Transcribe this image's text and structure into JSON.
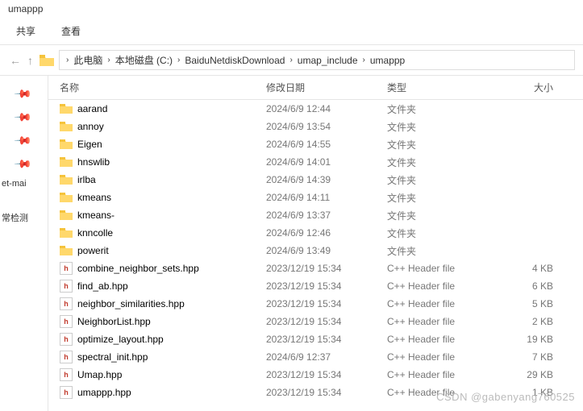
{
  "title": "umappp",
  "tabs": {
    "share": "共享",
    "view": "查看"
  },
  "breadcrumb": {
    "items": [
      "此电脑",
      "本地磁盘 (C:)",
      "BaiduNetdiskDownload",
      "umap_include",
      "umappp"
    ]
  },
  "sidebar": {
    "item1": "et-mai",
    "item2": "常检测"
  },
  "columns": {
    "name": "名称",
    "date": "修改日期",
    "type": "类型",
    "size": "大小"
  },
  "typeFolder": "文件夹",
  "typeHeader": "C++ Header file",
  "files": [
    {
      "name": "aarand",
      "date": "2024/6/9 12:44",
      "type": "folder",
      "size": ""
    },
    {
      "name": "annoy",
      "date": "2024/6/9 13:54",
      "type": "folder",
      "size": ""
    },
    {
      "name": "Eigen",
      "date": "2024/6/9 14:55",
      "type": "folder",
      "size": ""
    },
    {
      "name": "hnswlib",
      "date": "2024/6/9 14:01",
      "type": "folder",
      "size": ""
    },
    {
      "name": "irlba",
      "date": "2024/6/9 14:39",
      "type": "folder",
      "size": ""
    },
    {
      "name": "kmeans",
      "date": "2024/6/9 14:11",
      "type": "folder",
      "size": ""
    },
    {
      "name": "kmeans-",
      "date": "2024/6/9 13:37",
      "type": "folder",
      "size": ""
    },
    {
      "name": "knncolle",
      "date": "2024/6/9 12:46",
      "type": "folder",
      "size": ""
    },
    {
      "name": "powerit",
      "date": "2024/6/9 13:49",
      "type": "folder",
      "size": ""
    },
    {
      "name": "combine_neighbor_sets.hpp",
      "date": "2023/12/19 15:34",
      "type": "hpp",
      "size": "4 KB"
    },
    {
      "name": "find_ab.hpp",
      "date": "2023/12/19 15:34",
      "type": "hpp",
      "size": "6 KB"
    },
    {
      "name": "neighbor_similarities.hpp",
      "date": "2023/12/19 15:34",
      "type": "hpp",
      "size": "5 KB"
    },
    {
      "name": "NeighborList.hpp",
      "date": "2023/12/19 15:34",
      "type": "hpp",
      "size": "2 KB"
    },
    {
      "name": "optimize_layout.hpp",
      "date": "2023/12/19 15:34",
      "type": "hpp",
      "size": "19 KB"
    },
    {
      "name": "spectral_init.hpp",
      "date": "2024/6/9 12:37",
      "type": "hpp",
      "size": "7 KB"
    },
    {
      "name": "Umap.hpp",
      "date": "2023/12/19 15:34",
      "type": "hpp",
      "size": "29 KB"
    },
    {
      "name": "umappp.hpp",
      "date": "2023/12/19 15:34",
      "type": "hpp",
      "size": "1 KB"
    }
  ],
  "watermark": "CSDN @gabenyang760525"
}
